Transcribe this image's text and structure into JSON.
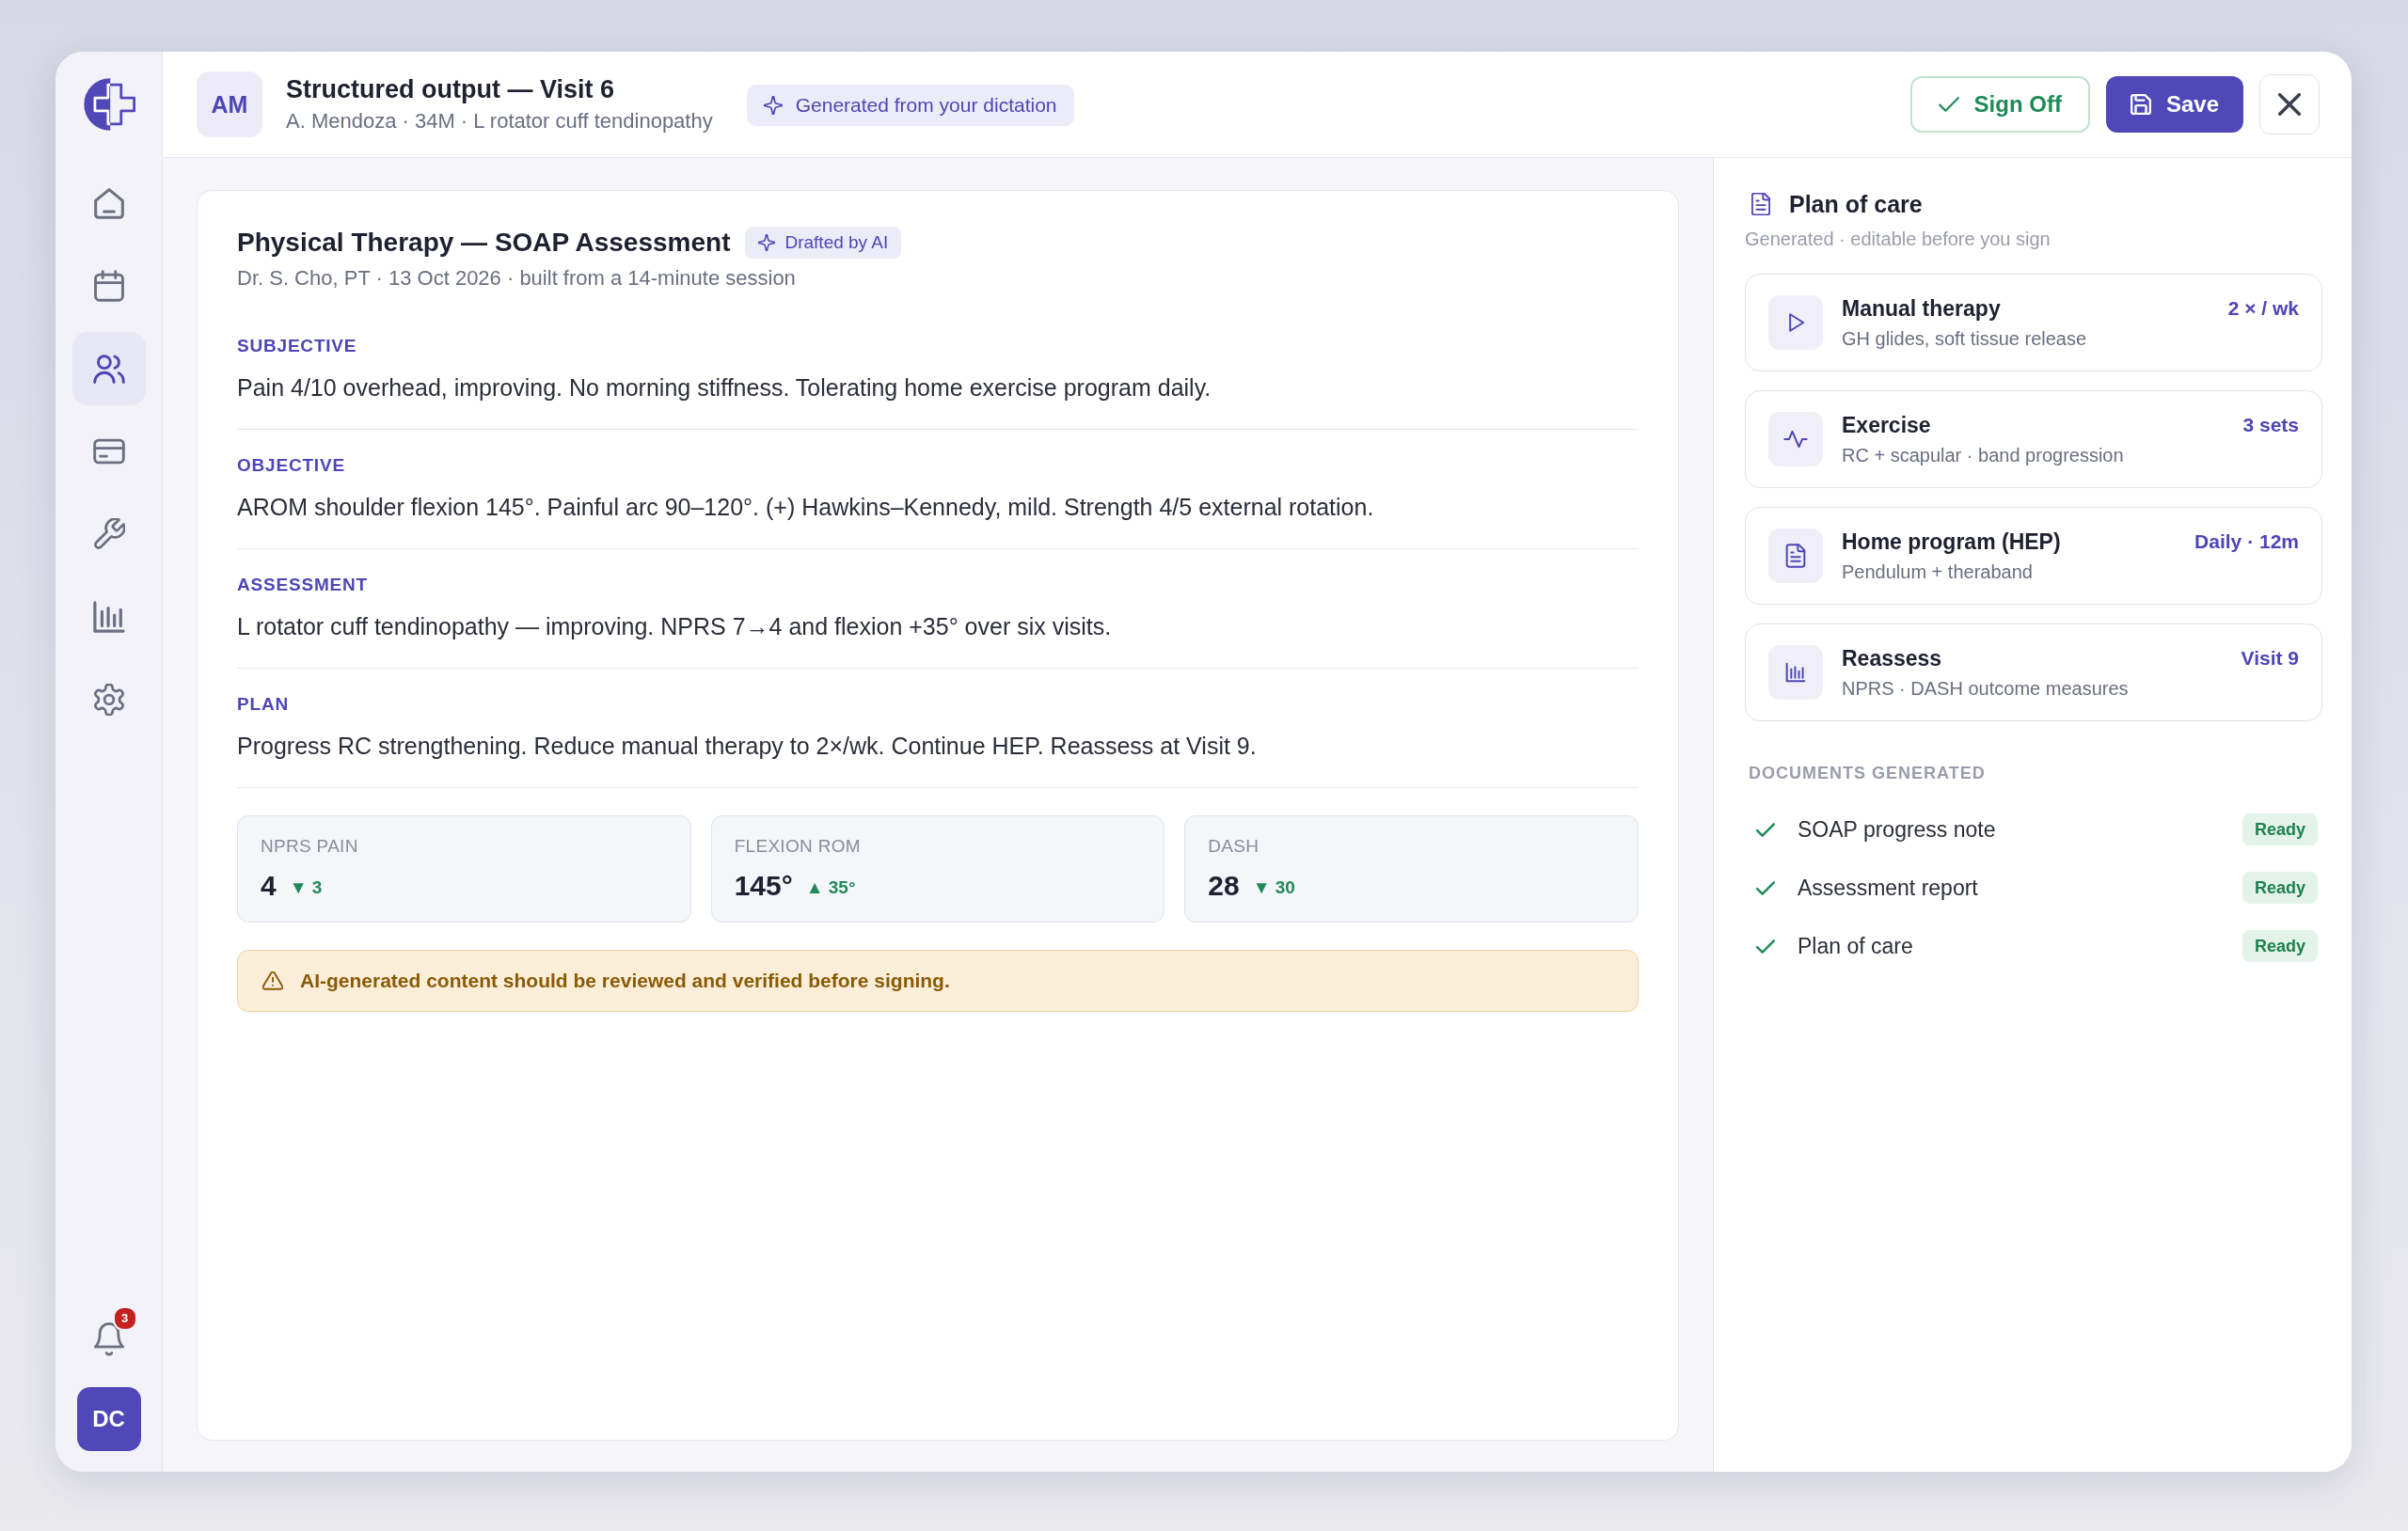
{
  "sidebar": {
    "nav": [
      {
        "kind": "home",
        "selected": false
      },
      {
        "kind": "calendar",
        "selected": false
      },
      {
        "kind": "patients",
        "selected": true
      },
      {
        "kind": "billing",
        "selected": false
      },
      {
        "kind": "tools",
        "selected": false
      },
      {
        "kind": "reports",
        "selected": false
      },
      {
        "kind": "settings",
        "selected": false
      }
    ],
    "notifications": "3",
    "user_initials": "DC"
  },
  "header": {
    "patient_initials": "AM",
    "title": "Structured output — Visit 6",
    "subtitle": "A. Mendoza · 34M · L rotator cuff tendinopathy",
    "tag": "Generated from your dictation",
    "actions": [
      {
        "kind": "sign_off",
        "label": "Sign Off"
      },
      {
        "kind": "save",
        "label": "Save"
      },
      {
        "kind": "close"
      }
    ]
  },
  "note": {
    "title": "Physical Therapy — SOAP Assessment",
    "tag": "Drafted by AI",
    "meta": "Dr. S. Cho, PT · 13 Oct 2026 · built from a 14-minute session",
    "sections": [
      {
        "heading": "SUBJECTIVE",
        "text": "Pain 4/10 overhead, improving. No morning stiffness. Tolerating home exercise program daily."
      },
      {
        "heading": "OBJECTIVE",
        "text": "AROM shoulder flexion 145°. Painful arc 90–120°. (+) Hawkins–Kennedy, mild. Strength 4/5 external rotation."
      },
      {
        "heading": "ASSESSMENT",
        "text": "L rotator cuff tendinopathy — improving. NPRS 7→4 and flexion +35° over six visits."
      },
      {
        "heading": "PLAN",
        "text": "Progress RC strengthening. Reduce manual therapy to 2×/wk. Continue HEP. Reassess at Visit 9."
      }
    ],
    "metrics": [
      {
        "label": "NPRS PAIN",
        "value": "4",
        "change": "▼ 3"
      },
      {
        "label": "FLEXION ROM",
        "value": "145°",
        "change": "▲ 35°"
      },
      {
        "label": "DASH",
        "value": "28",
        "change": "▼ 30"
      }
    ],
    "warning": "AI-generated content should be reviewed and verified before signing."
  },
  "plan_of_care": {
    "title": "Plan of care",
    "subtitle": "Generated · editable before you sign",
    "items": [
      {
        "kind": "manual",
        "title": "Manual therapy",
        "detail": "GH glides, soft tissue release",
        "frequency": "2 × / wk"
      },
      {
        "kind": "exercise",
        "title": "Exercise",
        "detail": "RC + scapular · band progression",
        "frequency": "3 sets"
      },
      {
        "kind": "home",
        "title": "Home program (HEP)",
        "detail": "Pendulum + theraband",
        "frequency": "Daily · 12m"
      },
      {
        "kind": "reassess",
        "title": "Reassess",
        "detail": "NPRS · DASH outcome measures",
        "frequency": "Visit 9"
      }
    ]
  },
  "documents": {
    "heading": "DOCUMENTS GENERATED",
    "items": [
      {
        "name": "SOAP progress note",
        "status": "Ready"
      },
      {
        "name": "Assessment report",
        "status": "Ready"
      },
      {
        "name": "Plan of care",
        "status": "Ready"
      }
    ]
  }
}
